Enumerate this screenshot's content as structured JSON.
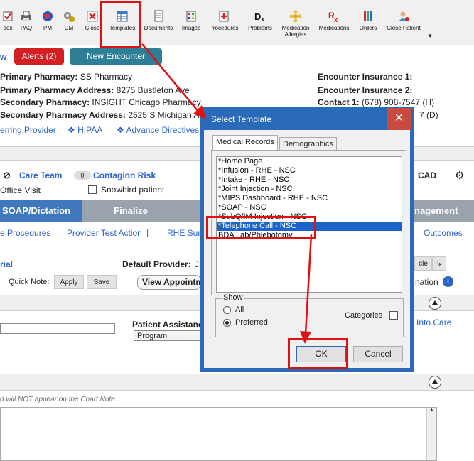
{
  "toolbar": {
    "items": [
      {
        "label": "box",
        "icon": "checkbox-icon"
      },
      {
        "label": "PAQ",
        "icon": "printer-icon"
      },
      {
        "label": "PM",
        "icon": "globe-icon"
      },
      {
        "label": "DM",
        "icon": "gears-icon"
      },
      {
        "label": "Close",
        "icon": "close-red-x-icon"
      },
      {
        "label": "Templates",
        "icon": "template-grid-icon"
      },
      {
        "label": "Documents",
        "icon": "document-icon"
      },
      {
        "label": "Images",
        "icon": "images-icon"
      },
      {
        "label": "Procedures",
        "icon": "procedures-icon"
      },
      {
        "label": "Problems",
        "icon": "dx-icon"
      },
      {
        "label": "Medication Allergies",
        "icon": "allergy-icon"
      },
      {
        "label": "Medications",
        "icon": "rx-icon"
      },
      {
        "label": "Orders",
        "icon": "orders-icon"
      },
      {
        "label": "Close Patient",
        "icon": "close-patient-icon"
      }
    ],
    "dropdown": "▼"
  },
  "nav": {
    "w": "w"
  },
  "alerts_label": "Alerts (2)",
  "new_encounter_label": "New Encounter",
  "pharmacy": {
    "primary_label": "Primary Pharmacy:",
    "primary_value": "SS Pharmacy",
    "primary_addr_label": "Primary Pharmacy Address:",
    "primary_addr_value": "8275 Bustleton Ave",
    "secondary_label": "Secondary Pharmacy:",
    "secondary_value": "INSIGHT Chicago Pharmacy",
    "secondary_addr_label": "Secondary Pharmacy Address:",
    "secondary_addr_value": "2525 S Michigan Ave"
  },
  "insurance": {
    "ins1_label": "Encounter Insurance 1:",
    "ins2_label": "Encounter Insurance 2:",
    "contact_label": "Contact 1:",
    "contact_value": "(678) 908-7547 (H)",
    "contact_extra": "7 (D)"
  },
  "links": {
    "referring": "erring Provider",
    "hipaa": "HIPAA",
    "advance": "Advance Directives"
  },
  "care": {
    "care_team": "Care Team",
    "contagion_count": "0",
    "contagion": "Contagion Risk",
    "cad": "CAD",
    "office_visit": "Office Visit",
    "snowbird": "Snowbird patient"
  },
  "tabs": {
    "soap": "SOAP/Dictation",
    "finalize": "Finalize",
    "management": "nagement"
  },
  "subnav": {
    "procedures": "e Procedures",
    "test_action": "Provider Test Action",
    "rhe": "RHE Sum",
    "outcomes": "Outcomes"
  },
  "row2": {
    "rial": "rial",
    "default_provider": "Default Provider:",
    "provider_trunc": "J",
    "cle": "cle",
    "quick_note": "Quick Note:",
    "apply": "Apply",
    "save": "Save",
    "view_appt": "View Appointm",
    "nation": "nation"
  },
  "lower": {
    "patient_assistance": "Patient Assistance",
    "program": "Program",
    "into_care": "Into Care",
    "note_warning": "d will NOT appear on the Chart Note."
  },
  "dialog": {
    "title": "Select Template",
    "close": "✕",
    "tab_medical": "Medical Records",
    "tab_demographics": "Demographics",
    "templates": [
      "*Home Page",
      "*Infusion - RHE - NSC",
      "*Intake - RHE - NSC",
      "*Joint Injection - NSC",
      "*MIPS Dashboard - RHE - NSC",
      "*SOAP - NSC",
      "*SubQ/IM Injection - NSC",
      "*Telephone Call - NSC",
      "BDA Lab/Phlebotomy"
    ],
    "selected_index": 7,
    "show_label": "Show",
    "show_all": "All",
    "show_preferred": "Preferred",
    "categories": "Categories",
    "ok": "OK",
    "cancel": "Cancel"
  },
  "colors": {
    "accent_blue": "#2a6ab8",
    "alert_red": "#d31e24",
    "teal": "#2e7f96",
    "annotation_red": "#e01010",
    "selection": "#1e64c8"
  }
}
